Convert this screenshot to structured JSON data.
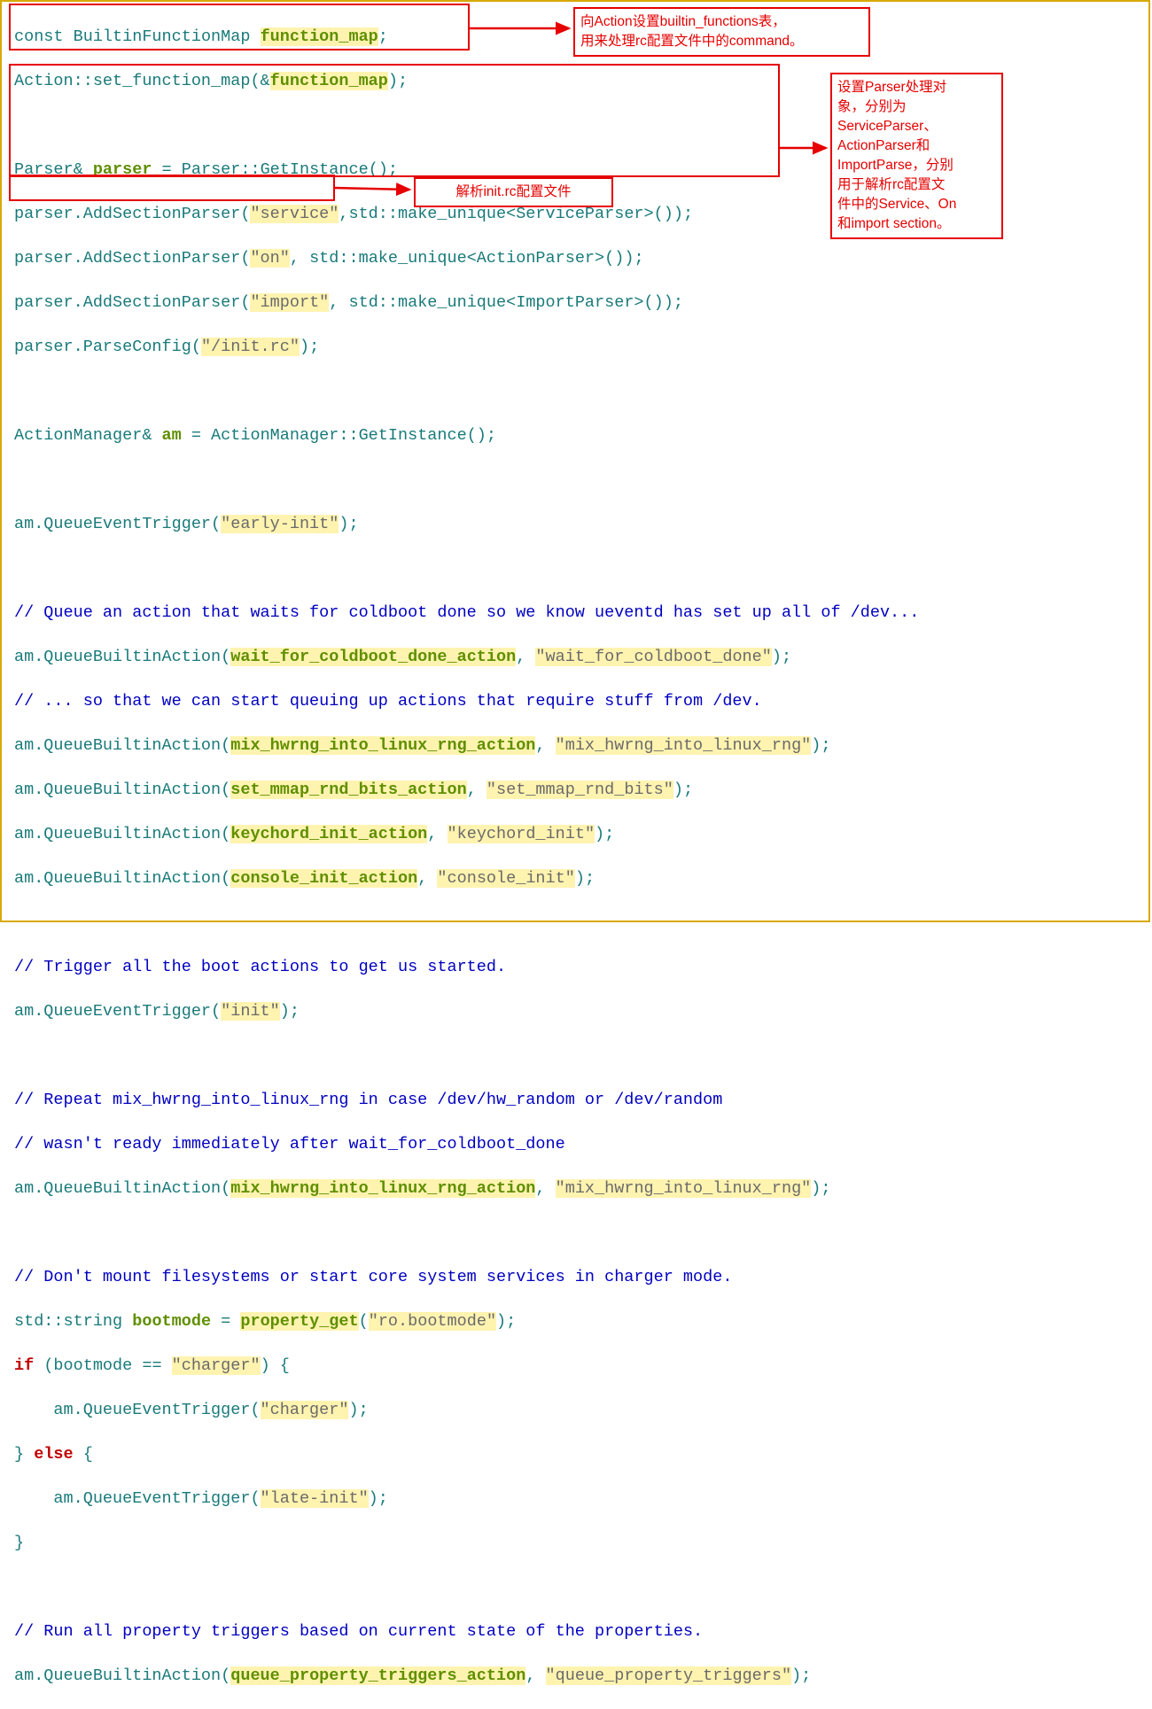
{
  "annotations": {
    "a1_line1": "向Action设置builtin_functions表，",
    "a1_line2": "用来处理rc配置文件中的command。",
    "a2_line1": "设置Parser处理对",
    "a2_line2": "象，分别为",
    "a2_line3": "ServiceParser、",
    "a2_line4": "ActionParser和",
    "a2_line5": "ImportParse，分别",
    "a2_line6": "用于解析rc配置文",
    "a2_line7": "件中的Service、On",
    "a2_line8": "和import section。",
    "a3": "解析init.rc配置文件"
  },
  "code": {
    "l1a": "const",
    "l1b": " BuiltinFunctionMap ",
    "l1c": "function_map",
    "l1d": ";",
    "l2a": "Action::set_function_map(&",
    "l2b": "function_map",
    "l2c": ");",
    "l4a": "Parser& ",
    "l4b": "parser",
    "l4c": " = Parser::GetInstance();",
    "l5a": "parser.AddSectionParser(",
    "l5b": "\"service\"",
    "l5c": ",std::make_unique<ServiceParser>());",
    "l6a": "parser.AddSectionParser(",
    "l6b": "\"on\"",
    "l6c": ", std::make_unique<ActionParser>());",
    "l7a": "parser.AddSectionParser(",
    "l7b": "\"import\"",
    "l7c": ", std::make_unique<ImportParser>());",
    "l8a": "parser.ParseConfig(",
    "l8b": "\"/init.rc\"",
    "l8c": ");",
    "l10a": "ActionManager& ",
    "l10b": "am",
    "l10c": " = ActionManager::GetInstance();",
    "l12a": "am.QueueEventTrigger(",
    "l12b": "\"early-init\"",
    "l12c": ");",
    "l14": "// Queue an action that waits for coldboot done so we know ueventd has set up all of /dev...",
    "l15a": "am.QueueBuiltinAction(",
    "l15b": "wait_for_coldboot_done_action",
    "l15c": ", ",
    "l15d": "\"wait_for_coldboot_done\"",
    "l15e": ");",
    "l16": "// ... so that we can start queuing up actions that require stuff from /dev.",
    "l17a": "am.QueueBuiltinAction(",
    "l17b": "mix_hwrng_into_linux_rng_action",
    "l17c": ", ",
    "l17d": "\"mix_hwrng_into_linux_rng\"",
    "l17e": ");",
    "l18a": "am.QueueBuiltinAction(",
    "l18b": "set_mmap_rnd_bits_action",
    "l18c": ", ",
    "l18d": "\"set_mmap_rnd_bits\"",
    "l18e": ");",
    "l19a": "am.QueueBuiltinAction(",
    "l19b": "keychord_init_action",
    "l19c": ", ",
    "l19d": "\"keychord_init\"",
    "l19e": ");",
    "l20a": "am.QueueBuiltinAction(",
    "l20b": "console_init_action",
    "l20c": ", ",
    "l20d": "\"console_init\"",
    "l20e": ");",
    "l22": "// Trigger all the boot actions to get us started.",
    "l23a": "am.QueueEventTrigger(",
    "l23b": "\"init\"",
    "l23c": ");",
    "l25": "// Repeat mix_hwrng_into_linux_rng in case /dev/hw_random or /dev/random",
    "l26": "// wasn't ready immediately after wait_for_coldboot_done",
    "l27a": "am.QueueBuiltinAction(",
    "l27b": "mix_hwrng_into_linux_rng_action",
    "l27c": ", ",
    "l27d": "\"mix_hwrng_into_linux_rng\"",
    "l27e": ");",
    "l29": "// Don't mount filesystems or start core system services in charger mode.",
    "l30a": "std::string ",
    "l30b": "bootmode",
    "l30c": " = ",
    "l30d": "property_get",
    "l30e": "(",
    "l30f": "\"ro.bootmode\"",
    "l30g": ");",
    "l31a": "if",
    "l31b": " (bootmode == ",
    "l31c": "\"charger\"",
    "l31d": ") {",
    "l32a": "    am.QueueEventTrigger(",
    "l32b": "\"charger\"",
    "l32c": ");",
    "l33a": "} ",
    "l33b": "else",
    "l33c": " {",
    "l34a": "    am.QueueEventTrigger(",
    "l34b": "\"late-init\"",
    "l34c": ");",
    "l35": "}",
    "l37": "// Run all property triggers based on current state of the properties.",
    "l38a": "am.QueueBuiltinAction(",
    "l38b": "queue_property_triggers_action",
    "l38c": ", ",
    "l38d": "\"queue_property_triggers\"",
    "l38e": ");"
  }
}
